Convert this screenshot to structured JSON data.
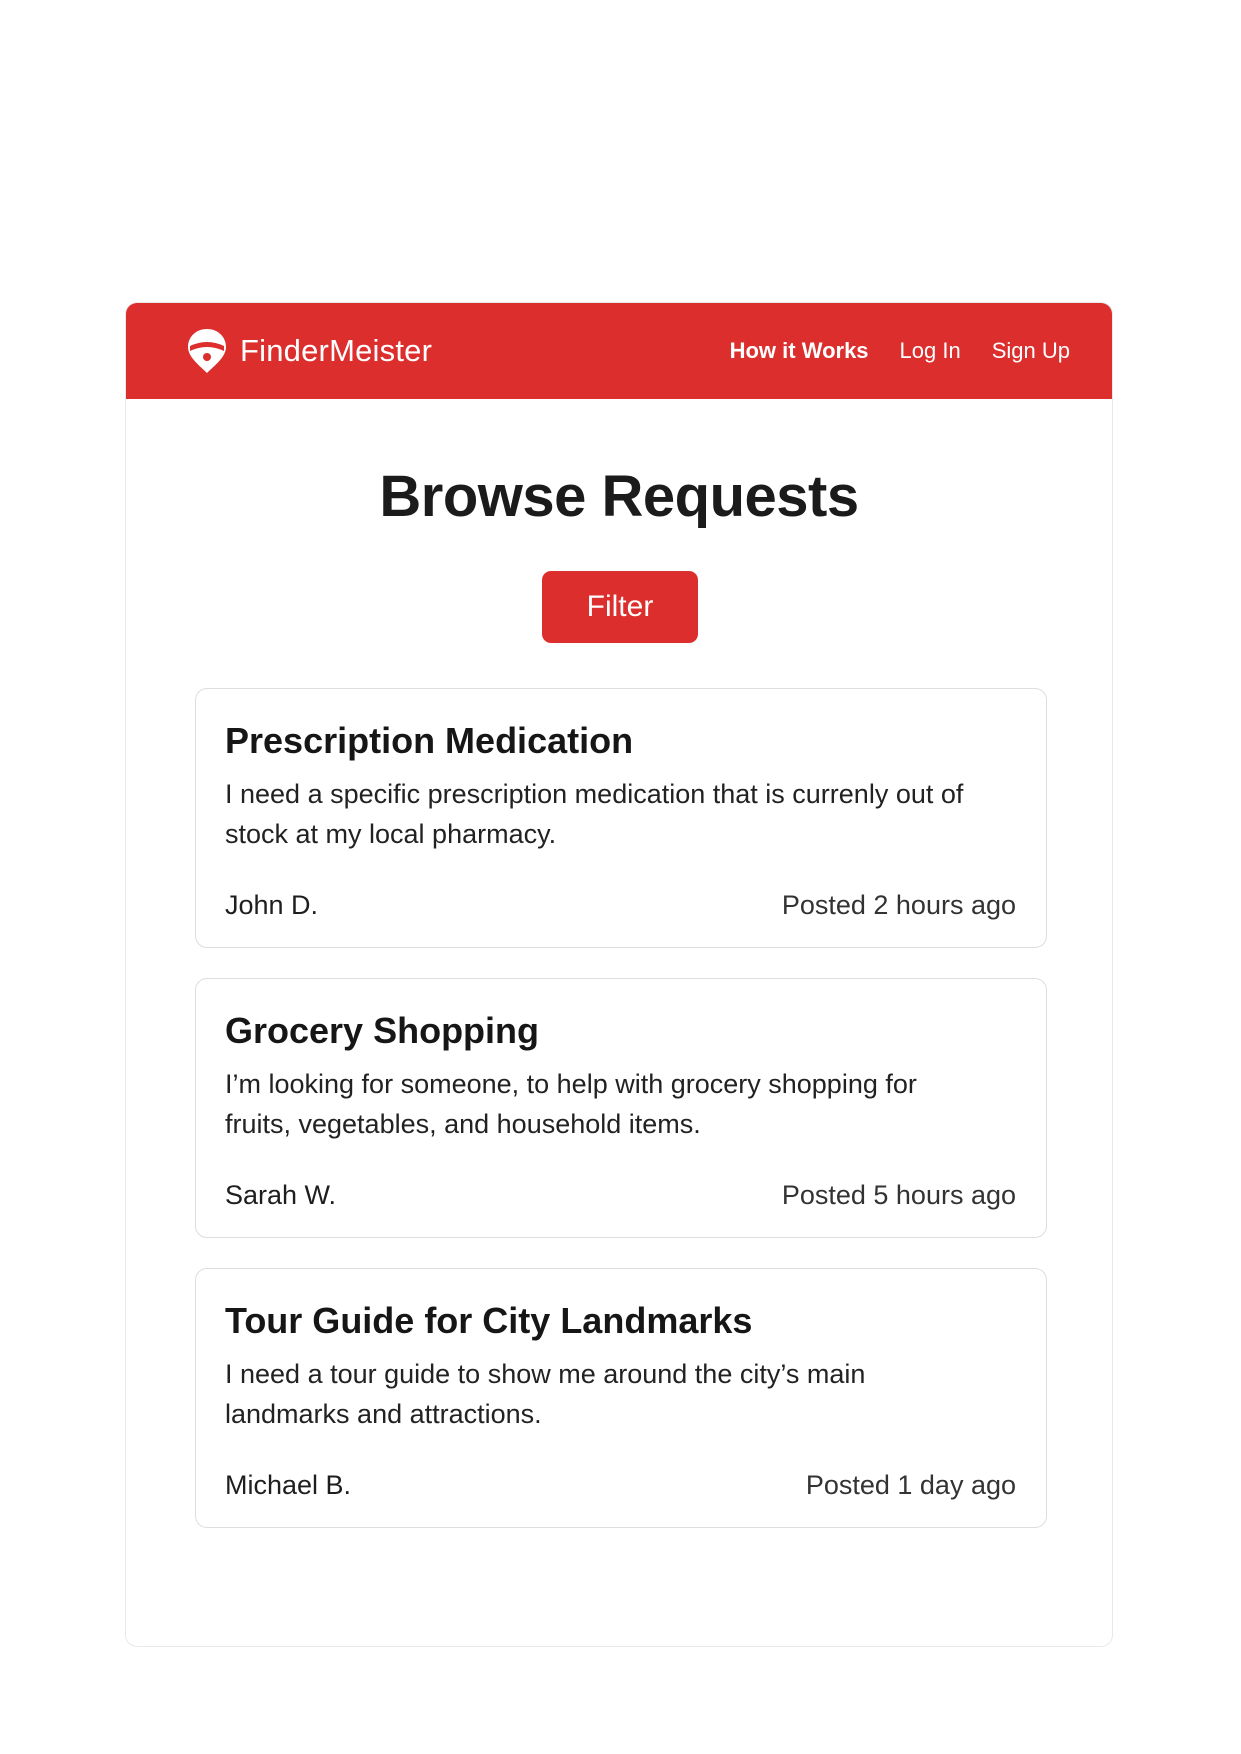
{
  "brand": {
    "name": "FinderMeister",
    "logo_icon": "location-pin-icon",
    "accent_color": "#dd2e2e"
  },
  "nav": {
    "links": [
      {
        "label": "How it Works"
      },
      {
        "label": "Log In"
      },
      {
        "label": "Sign Up"
      }
    ]
  },
  "main": {
    "title": "Browse Requests",
    "filter_label": "Filter"
  },
  "requests": [
    {
      "title": "Prescription Medication",
      "description": "I need a specific prescription medication that is currenly out of stock at my local pharmacy.",
      "author": "John D.",
      "posted": "Posted 2 hours ago"
    },
    {
      "title": "Grocery Shopping",
      "description": "I’m looking for someone, to help with grocery shopping for fruits, vegetables, and household items.",
      "author": "Sarah W.",
      "posted": "Posted 5 hours ago"
    },
    {
      "title": "Tour Guide for City Landmarks",
      "description": "I need a tour guide to show me around the city’s main landmarks and attractions.",
      "author": "Michael B.",
      "posted": "Posted 1 day ago"
    }
  ]
}
